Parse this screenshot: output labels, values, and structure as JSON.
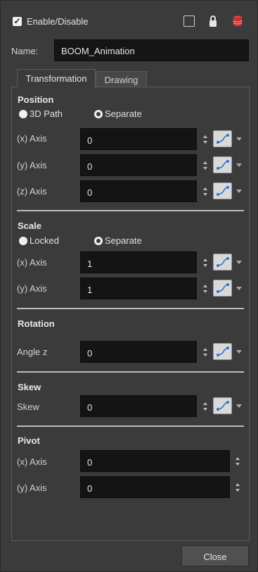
{
  "header": {
    "enable_label": "Enable/Disable",
    "enable_checked": true,
    "icons": [
      "display-toggle-icon",
      "lock-icon",
      "database-icon"
    ]
  },
  "name": {
    "label": "Name:",
    "value": "BOOM_Animation"
  },
  "tabs": [
    {
      "label": "Transformation",
      "active": true
    },
    {
      "label": "Drawing",
      "active": false
    }
  ],
  "position": {
    "title": "Position",
    "radio_a": "3D Path",
    "radio_b": "Separate",
    "x": {
      "label": "(x) Axis",
      "value": "0"
    },
    "y": {
      "label": "(y) Axis",
      "value": "0"
    },
    "z": {
      "label": "(z) Axis",
      "value": "0"
    }
  },
  "scale": {
    "title": "Scale",
    "radio_a": "Locked",
    "radio_b": "Separate",
    "x": {
      "label": "(x) Axis",
      "value": "1"
    },
    "y": {
      "label": "(y) Axis",
      "value": "1"
    }
  },
  "rotation": {
    "title": "Rotation",
    "angle": {
      "label": "Angle z",
      "value": "0"
    }
  },
  "skew": {
    "title": "Skew",
    "skew": {
      "label": "Skew",
      "value": "0"
    }
  },
  "pivot": {
    "title": "Pivot",
    "x": {
      "label": "(x) Axis",
      "value": "0"
    },
    "y": {
      "label": "(y) Axis",
      "value": "0"
    }
  },
  "footer": {
    "close_label": "Close"
  },
  "colors": {
    "background": "#3b3b3b",
    "field_bg": "#141414",
    "function_button": "#d9d9d9",
    "function_icon": "#3a7ad8",
    "database_icon": "#d83a3a"
  }
}
